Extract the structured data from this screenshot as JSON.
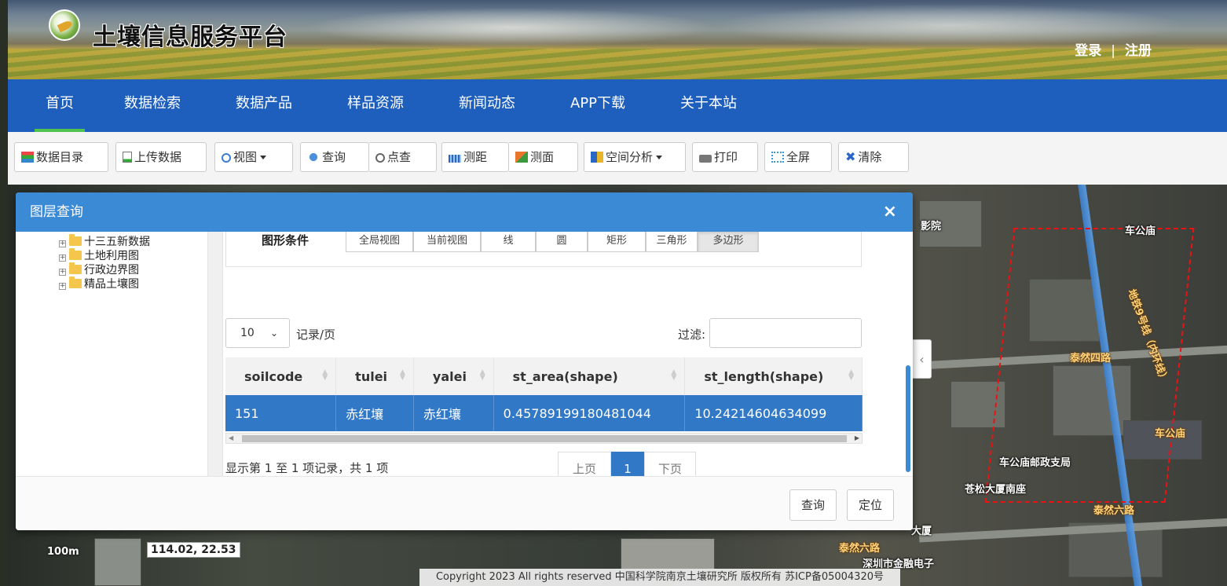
{
  "site": {
    "title": "土壤信息服务平台",
    "login": "登录",
    "separator": "|",
    "register": "注册"
  },
  "nav": {
    "items": [
      "首页",
      "数据检索",
      "数据产品",
      "样品资源",
      "新闻动态",
      "APP下载",
      "关于本站"
    ],
    "active_index": 0
  },
  "toolbar": {
    "catalog": "数据目录",
    "upload": "上传数据",
    "view": "视图",
    "query": "查询",
    "point_query": "点查",
    "measure_distance": "测距",
    "measure_area": "测面",
    "spatial_analysis": "空间分析",
    "print": "打印",
    "fullscreen": "全屏",
    "clear": "清除"
  },
  "dialog": {
    "title": "图层查询",
    "close": "×",
    "tree": [
      "十三五新数据",
      "土地利用图",
      "行政边界图",
      "精品土壤图"
    ],
    "condition_label": "图形条件",
    "condition_buttons": [
      "全局视图",
      "当前视图",
      "线",
      "圆",
      "矩形",
      "三角形",
      "多边形"
    ],
    "condition_active": "多边形",
    "page_size": "10",
    "records_per_page": "记录/页",
    "filter_label": "过滤:",
    "filter_value": "",
    "table": {
      "columns": [
        "soilcode",
        "tulei",
        "yalei",
        "st_area(shape)",
        "st_length(shape)"
      ],
      "rows": [
        [
          "151",
          "赤红壤",
          "赤红壤",
          "0.45789199180481044",
          "10.24214604634099"
        ]
      ]
    },
    "info": "显示第 1 至 1 项记录，共 1 项",
    "pager": {
      "prev": "上页",
      "current": "1",
      "next": "下页"
    },
    "footer": {
      "query": "查询",
      "locate": "定位"
    }
  },
  "map": {
    "labels": {
      "cinema": "影院",
      "chegongmiao_top": "车公庙",
      "metro_line": "地铁9号线（内环线）",
      "tairan_4": "泰然四路",
      "chegongmiao": "车公庙",
      "post_office": "车公庙邮政支局",
      "cangsong": "苍松大厦南座",
      "tairan_6": "泰然六路",
      "tairan_6b": "泰然六路",
      "finance": "深圳市金融电子",
      "building": "大厦"
    },
    "scale": "100m",
    "coordinates": "114.02, 22.53"
  },
  "copyright": "Copyright 2023 All rights reserved 中国科学院南京土壤研究所 版权所有 苏ICP备05004320号",
  "colors": {
    "nav_blue": "#1e5fbe",
    "dialog_header": "#3a8ad6",
    "row_selected": "#3178c6",
    "active_underline": "#4fc24f",
    "polygon_dash": "#ee1111"
  }
}
